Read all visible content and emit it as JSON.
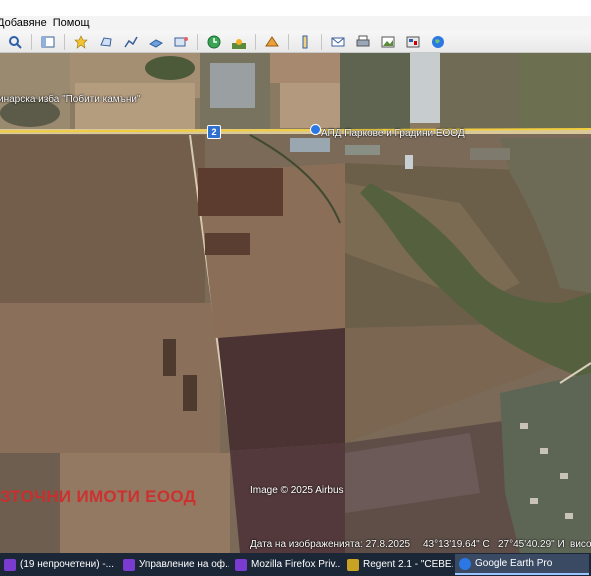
{
  "menu": {
    "items": [
      {
        "label": "Добавяне"
      },
      {
        "label": "Помощ"
      }
    ]
  },
  "toolbar": {
    "buttons": [
      "search-icon",
      "sidebar-toggle-icon",
      "placemark-icon",
      "polygon-icon",
      "path-icon",
      "image-overlay-icon",
      "tour-icon",
      "historical-imagery-icon",
      "sunlight-icon",
      "planets-icon",
      "ruler-icon",
      "email-icon",
      "print-icon",
      "save-image-icon",
      "maps-icon",
      "globe-icon"
    ]
  },
  "map": {
    "road_number": "2",
    "labels": {
      "place1": "инарска изба \"Побити камъни\"",
      "place2": "АПД Паркове и Градини ЕООД"
    },
    "overlay_title": "ЗТОЧНИ ИМОТИ ЕООД",
    "copyright": "Image © 2025 Airbus"
  },
  "status": {
    "date": "Дата на изображенията: 27.8.2025",
    "lat": "43°13'19.64\" С",
    "lon": "27°45'40.29\" И",
    "elev": "висо"
  },
  "taskbar": {
    "tasks": [
      {
        "label": "(19 непрочетени) -...",
        "color": "#7a3bd1"
      },
      {
        "label": "Управление на оф...",
        "color": "#7a3bd1"
      },
      {
        "label": "Mozilla Firefox Priv...",
        "color": "#7a3bd1"
      },
      {
        "label": "Regent 2.1 - \"СЕВЕ...",
        "color": "#c9a321"
      },
      {
        "label": "Google Earth Pro",
        "color": "#2b78e4"
      }
    ]
  }
}
